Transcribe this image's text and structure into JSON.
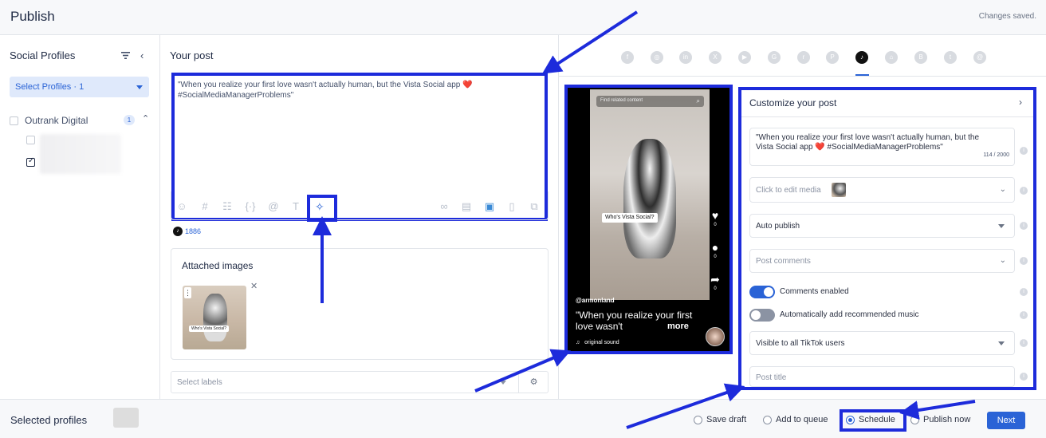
{
  "header": {
    "title": "Publish",
    "status": "Changes saved."
  },
  "sidebar": {
    "title": "Social Profiles",
    "select_label": "Select Profiles · 1",
    "group_name": "Outrank Digital",
    "group_count": "1"
  },
  "editor": {
    "title": "Your post",
    "post_text": "\"When you realize your first love wasn't actually human, but the Vista Social app ❤️ #SocialMediaManagerProblems\"",
    "char_count": "1886",
    "attached_title": "Attached images",
    "thumb_pill": "Who's Vista Social?",
    "labels_placeholder": "Select labels",
    "toolbar_icons": [
      "emoji-icon",
      "hashtag-icon",
      "variable-icon",
      "code-braces-icon",
      "mention-icon",
      "text-icon",
      "magic-wand-icon",
      "link-icon",
      "media-library-icon",
      "camera-icon",
      "file-icon",
      "gallery-icon"
    ]
  },
  "platforms": [
    "facebook",
    "instagram",
    "linkedin",
    "x",
    "youtube",
    "google-business",
    "reddit",
    "pinterest",
    "tiktok",
    "snapchat",
    "blogger",
    "tumblr",
    "threads"
  ],
  "preview": {
    "search_placeholder": "Find related content",
    "pill_text": "Who's Vista Social?",
    "likes": "0",
    "comments": "0",
    "shares": "0",
    "username": "@armonland",
    "caption": "\"When you realize your first love wasn't",
    "more": "more",
    "sound": "original sound"
  },
  "customize": {
    "title": "Customize your post",
    "text": "\"When you realize your first love wasn't actually human, but the Vista Social app ❤️ #SocialMediaManagerProblems\"",
    "text_count": "114 / 2000",
    "media_label": "Click to edit media",
    "publish_mode": "Auto publish",
    "post_comments": "Post comments",
    "comments_toggle_label": "Comments enabled",
    "music_toggle_label": "Automatically add recommended music",
    "visibility": "Visible to all TikTok users",
    "post_title_placeholder": "Post title",
    "comments_enabled": true,
    "music_enabled": false
  },
  "footer": {
    "selected_label": "Selected profiles",
    "options": [
      "Save draft",
      "Add to queue",
      "Schedule",
      "Publish now"
    ],
    "selected_option": "Schedule",
    "next_label": "Next"
  },
  "colors": {
    "accent": "#2a63d6",
    "annotation": "#1d2bdb"
  }
}
